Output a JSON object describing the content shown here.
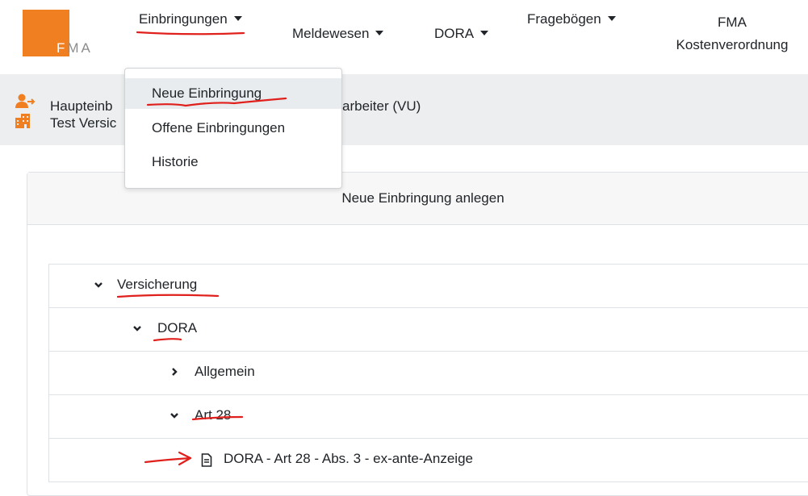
{
  "brand": {
    "logo_letters_f": "F",
    "logo_letters_ma": "MA"
  },
  "nav": {
    "einbringungen": "Einbringungen",
    "meldewesen": "Meldewesen",
    "dora": "DORA",
    "frageboegen": "Fragebögen",
    "fma_line1": "FMA",
    "fma_line2": "Kostenverordnung"
  },
  "dropdown": {
    "items": [
      "Neue Einbringung",
      "Offene Einbringungen",
      "Historie"
    ]
  },
  "userband": {
    "line1_start": "Haupteinb",
    "line1_end": "arbeiter (VU)",
    "line2_start": "Test Versic"
  },
  "card": {
    "header": "Neue Einbringung anlegen"
  },
  "tree": {
    "nodes": [
      {
        "label": "Versicherung",
        "state": "expanded"
      },
      {
        "label": "DORA",
        "state": "expanded"
      },
      {
        "label": "Allgemein",
        "state": "collapsed"
      },
      {
        "label": "Art 28",
        "state": "expanded"
      }
    ],
    "document": {
      "label_bold": "DORA",
      "label_rest": " - Art 28 - Abs. 3 - ex-ante-Anzeige",
      "icon": "file-text-icon"
    }
  },
  "colors": {
    "brand_orange": "#f07f22",
    "annotation_red": "#e0201c",
    "band_gray": "#eceeef"
  }
}
